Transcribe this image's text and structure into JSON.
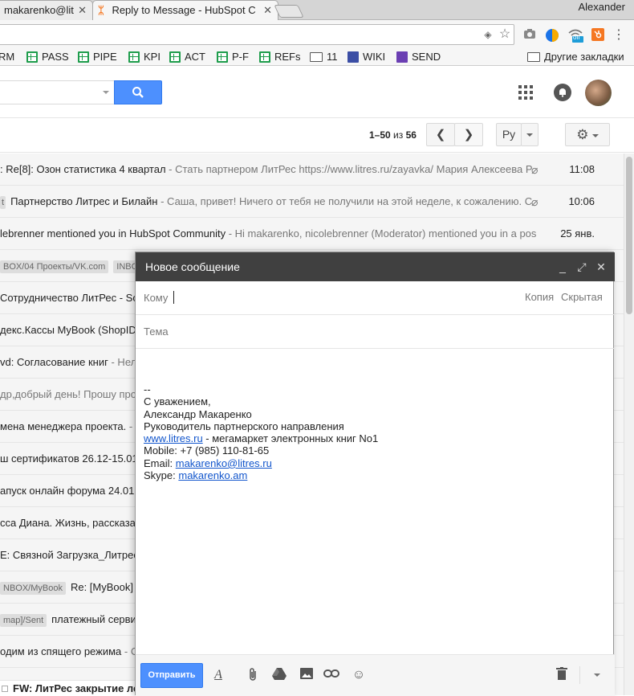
{
  "browser": {
    "tabs": [
      {
        "label": "makarenko@lit"
      },
      {
        "label": "Reply to Message - HubSpot C"
      }
    ],
    "profile_name": "Alexander",
    "extension_badge": "off"
  },
  "bookmarks": [
    {
      "label": "RM",
      "icon": "sheet-icon"
    },
    {
      "label": "PASS",
      "icon": "sheet-icon"
    },
    {
      "label": "PIPE",
      "icon": "sheet-icon"
    },
    {
      "label": "KPI",
      "icon": "sheet-icon"
    },
    {
      "label": "ACT",
      "icon": "sheet-icon"
    },
    {
      "label": "P-F",
      "icon": "sheet-icon"
    },
    {
      "label": "REFs",
      "icon": "sheet-icon"
    },
    {
      "label": "11",
      "icon": "folder-icon"
    },
    {
      "label": "WIKI",
      "icon": "wiki-icon"
    },
    {
      "label": "SEND",
      "icon": "form-icon"
    },
    {
      "label": "Другие закладки",
      "icon": "folder-icon"
    }
  ],
  "pager": {
    "range": "1–50",
    "of": "из",
    "total": "56",
    "lang": "Ру"
  },
  "mail_rows": [
    {
      "sender": ": Re[8]: Озон статистика 4 квартал",
      "snippet": " - Стать партнером ЛитРес https://www.litres.ru/zayavka/ Мария Алексеева Р",
      "time": "11:08",
      "attach": true
    },
    {
      "label": "t",
      "sender": "Партнерство Литрес и Билайн",
      "snippet": " - Саша, привет! Ничего от тебя не получили на этой неделе, к сожалению. С",
      "time": "10:06",
      "attach": true
    },
    {
      "sender": "lebrenner mentioned you in HubSpot Community",
      "snippet": " - Hi makarenko, nicolebrenner (Moderator) mentioned you in a pos",
      "time": "25 янв.",
      "attach": false
    },
    {
      "label": "BOX/04 Проекты/VK.com",
      "label2": "INBO",
      "sender": "",
      "snippet": "",
      "time": "",
      "attach": false
    },
    {
      "sender": " Сотрудничество ЛитРес - So",
      "snippet": "",
      "time": "",
      "attach": false
    },
    {
      "sender": "декс.Кассы MyBook (ShopID",
      "snippet": "",
      "time": "",
      "attach": false
    },
    {
      "sender": "vd: Согласование книг",
      "snippet": " - Нелл",
      "time": "",
      "attach": false
    },
    {
      "sender": "",
      "snippet": "др,добрый день! Прошу про",
      "time": "",
      "attach": false
    },
    {
      "sender": "мена менеджера проекта.",
      "snippet": " - С",
      "time": "",
      "attach": false
    },
    {
      "sender": "ш сертификатов 26.12-15.01",
      "snippet": "",
      "time": "",
      "attach": false
    },
    {
      "sender": "апуск онлайн форума 24.01",
      "snippet": "",
      "time": "",
      "attach": false
    },
    {
      "sender": "сса Диана. Жизнь, рассказан",
      "snippet": "",
      "time": "",
      "attach": false
    },
    {
      "sender": "E: Связной Загрузка_Литрес",
      "snippet": "",
      "time": "",
      "attach": false
    },
    {
      "label": "NBOX/MyBook",
      "sender": "Re: [MyBook] в",
      "snippet": "",
      "time": "",
      "attach": false
    },
    {
      "label": "map]/Sent",
      "sender": "платежный сервис",
      "snippet": "",
      "time": "",
      "attach": false
    },
    {
      "sender": "одим из спящего режима",
      "snippet": " - С",
      "time": "",
      "attach": false
    }
  ],
  "bottom_row": "FW: ЛитРес закрытие ле",
  "compose": {
    "title": "Новое сообщение",
    "to_label": "Кому",
    "cc_label": "Копия",
    "bcc_label": "Скрытая",
    "subject_label": "Тема",
    "signature": {
      "dashes": "--",
      "greeting": "С уважением,",
      "name": "Александр Макаренко",
      "position": "Руководитель партнерского направления",
      "site_link": "www.litres.ru",
      "site_tail": " - мегамаркет электронных книг No1",
      "mobile": "Mobile: +7 (985) 110-81-65",
      "email_label": "Email: ",
      "email": "makarenko@litres.ru",
      "skype_label": "Skype: ",
      "skype": "makarenko.am"
    },
    "send_label": "Отправить"
  }
}
